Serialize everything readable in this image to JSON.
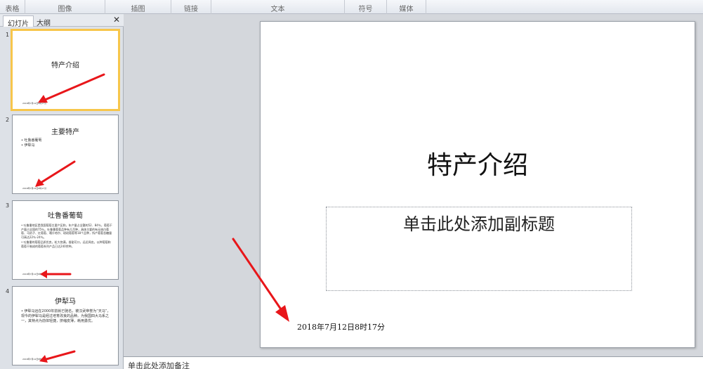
{
  "ribbon": {
    "groups": [
      "表格",
      "图像",
      "插图",
      "链接",
      "文本",
      "符号",
      "媒体"
    ]
  },
  "pane": {
    "tabs": [
      "幻灯片",
      "大纲"
    ],
    "close_glyph": "✕"
  },
  "slides": [
    {
      "num": "1",
      "title": "特产介绍",
      "bullets": [],
      "footer": "2018年7月12日8时17分"
    },
    {
      "num": "2",
      "title": "主要特产",
      "bullets": [
        "吐鲁番葡萄",
        "伊犁马"
      ],
      "footer": "2018年7月12日8时17分"
    },
    {
      "num": "3",
      "title": "吐鲁番葡萄",
      "bullets": [
        "吐鲁番地区是我国葡萄主要产区和，年产量占全疆的52．84％，葡萄干产量占全国的75％。吐鲁番葡萄品种有几百种，具体主要的有无核白葡萄、马奶子、红葡萄、喀什哈尔、琐琐葡萄等18个品种，所产葡萄含糖量可高达22％-24％。",
        "吐鲁番的葡萄品质优良，粒大饱满，香甜可口，远近闻名。以种葡萄和葡萄干制成的葡萄系列产品已达240余种。"
      ],
      "footer": "2018年7月12日8时17分"
    },
    {
      "num": "4",
      "title": "伊犁马",
      "bullets": [
        "伊犁马远在2000年前就已驰名，被汉武帝誉为“天马”，现今的伊犁马是经过培育改良的品种。为我国四大马系之一，其特点为前体轻捷，挤缩皮薄，耗用勇优。"
      ],
      "footer": "2018年7月12日8时17分"
    }
  ],
  "main_slide": {
    "title": "特产介绍",
    "subtitle_placeholder": "单击此处添加副标题",
    "date": "2018年7月12日8时17分"
  },
  "notes": {
    "placeholder": "单击此处添加备注"
  },
  "colors": {
    "selected_border": "#f7c64b",
    "annotation_arrow": "#e8161a"
  }
}
